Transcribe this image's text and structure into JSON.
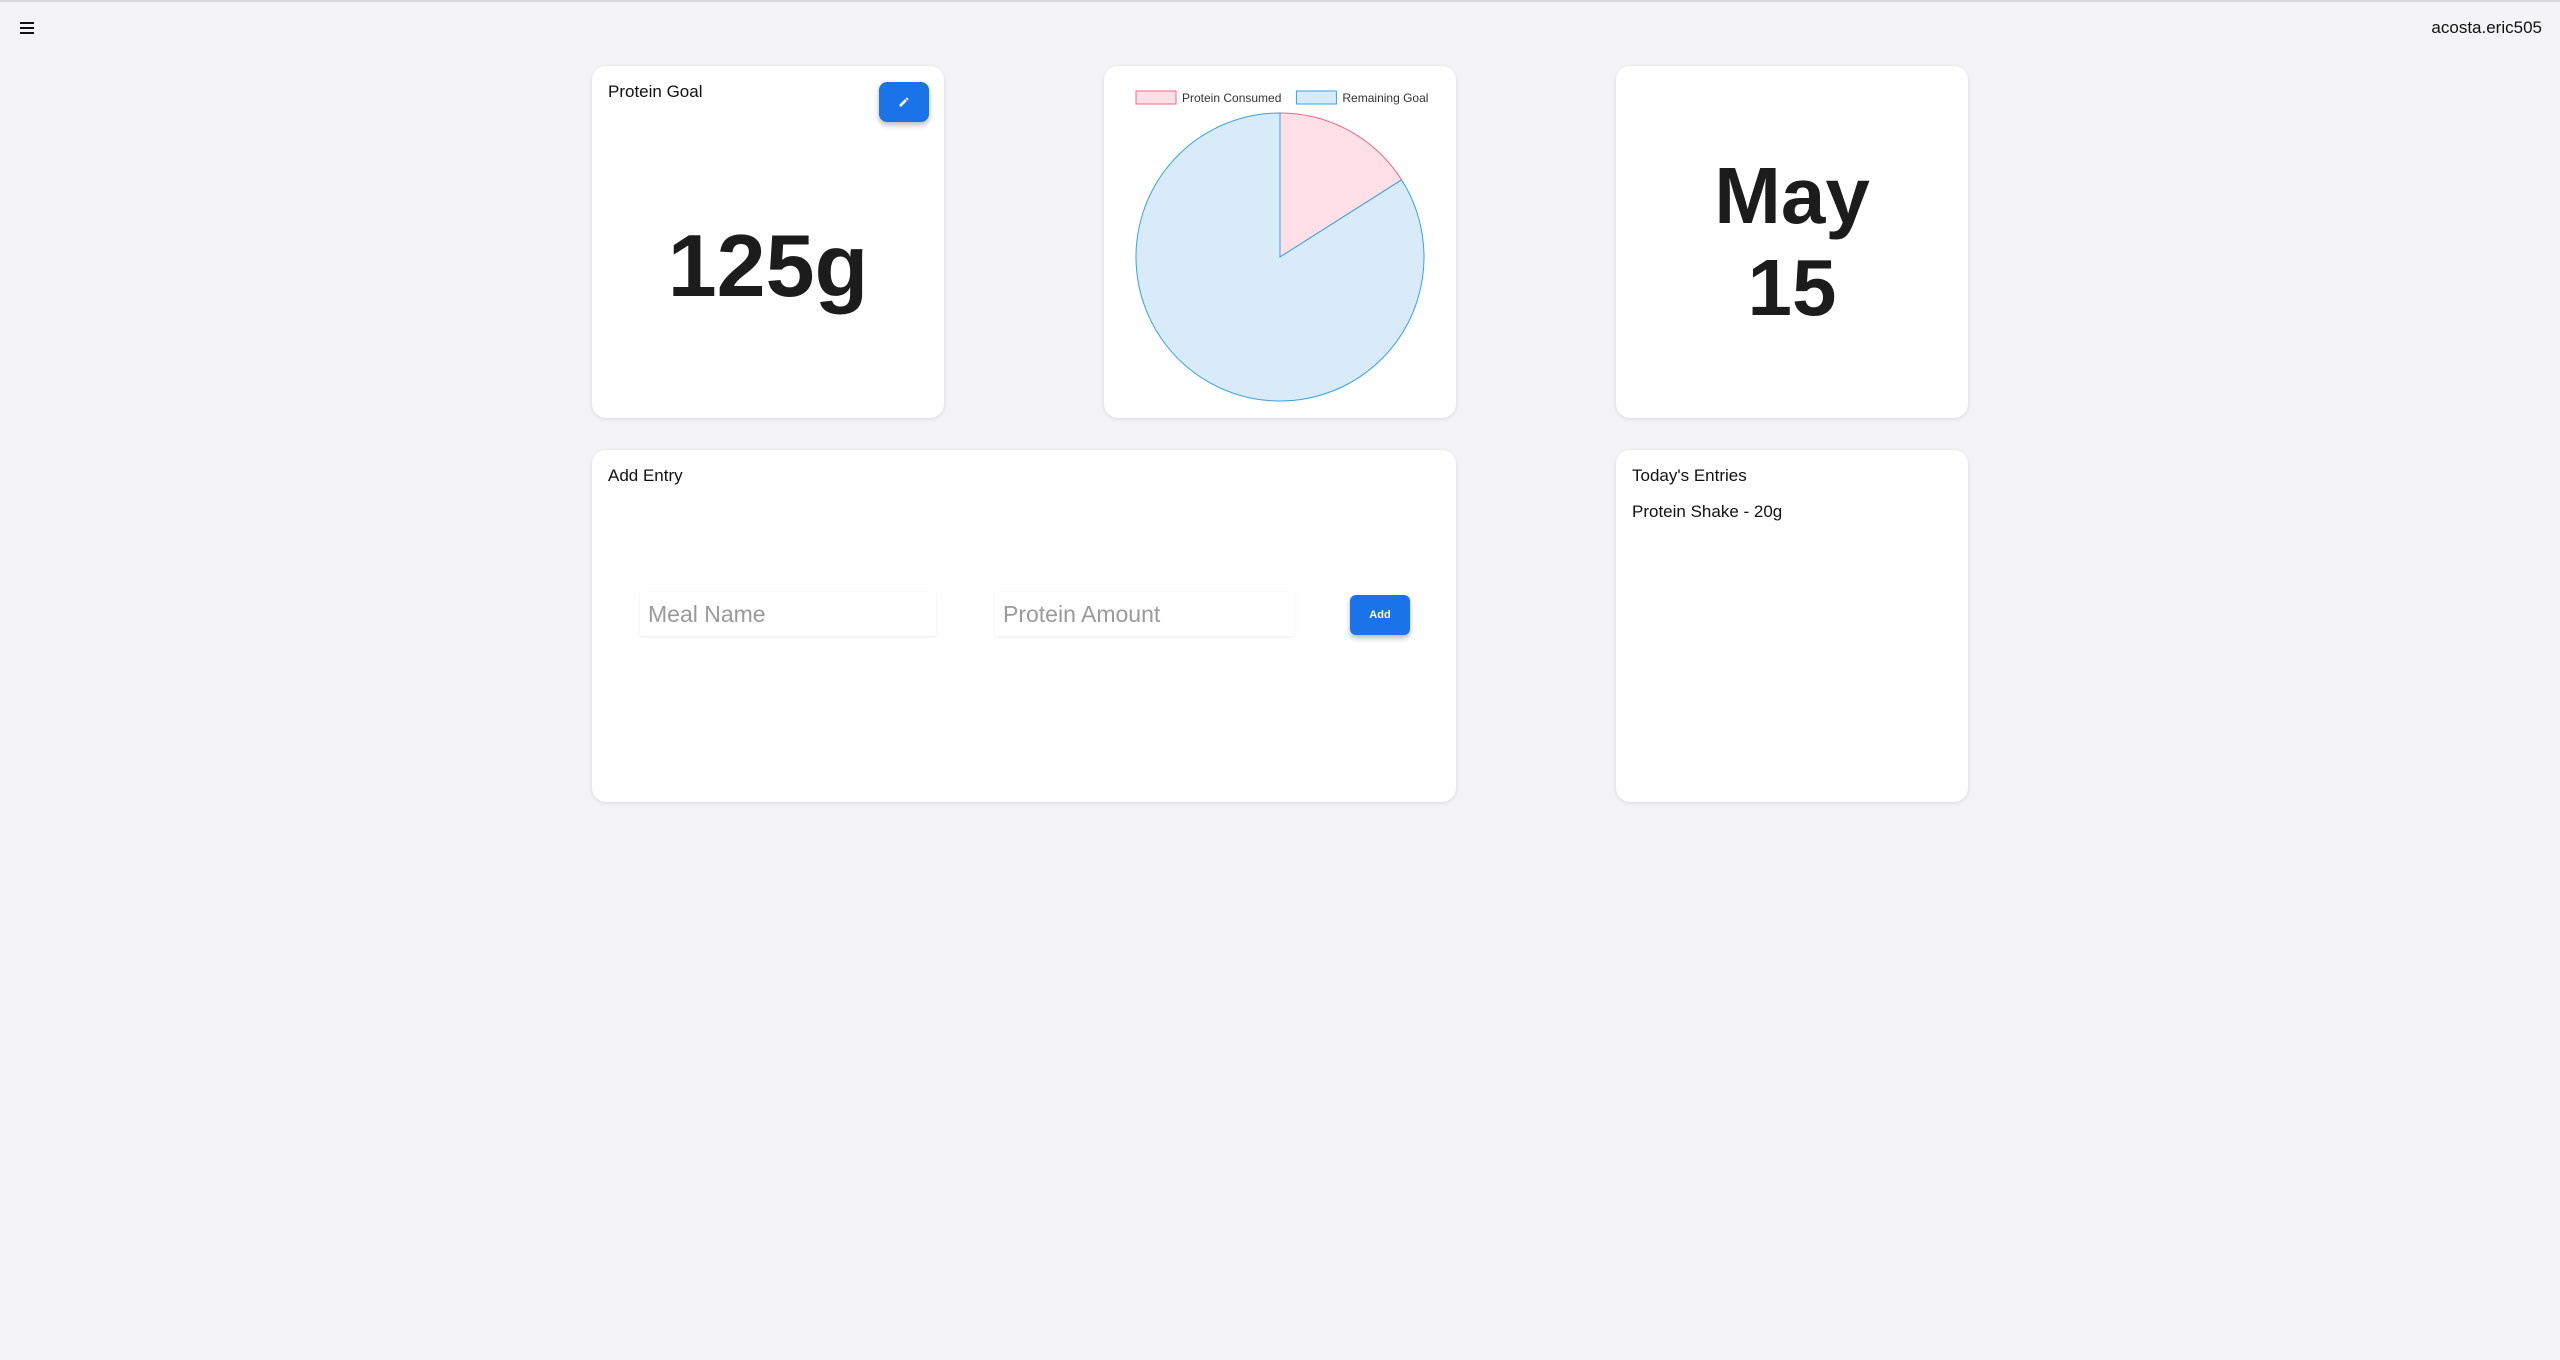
{
  "header": {
    "menu_icon": "hamburger-menu-icon",
    "username": "acosta.eric505"
  },
  "goal_card": {
    "title": "Protein Goal",
    "edit_icon": "pencil-icon",
    "value": "125g"
  },
  "chart_data": {
    "type": "pie",
    "legend_position": "top",
    "slices": [
      {
        "name": "Protein Consumed",
        "value": 20,
        "fill": "#ffe0e6",
        "stroke": "#ff6384"
      },
      {
        "name": "Remaining Goal",
        "value": 105,
        "fill": "#d9ebf9",
        "stroke": "#36a2eb"
      }
    ]
  },
  "date_card": {
    "month": "May",
    "day": "15"
  },
  "entry_card": {
    "title": "Add Entry",
    "meal_placeholder": "Meal Name",
    "protein_placeholder": "Protein Amount",
    "add_label": "Add"
  },
  "entries_card": {
    "title": "Today's Entries",
    "items": [
      "Protein Shake - 20g"
    ]
  },
  "colors": {
    "background": "#f4f4f6",
    "accent": "#1a73e8",
    "card": "#ffffff"
  }
}
